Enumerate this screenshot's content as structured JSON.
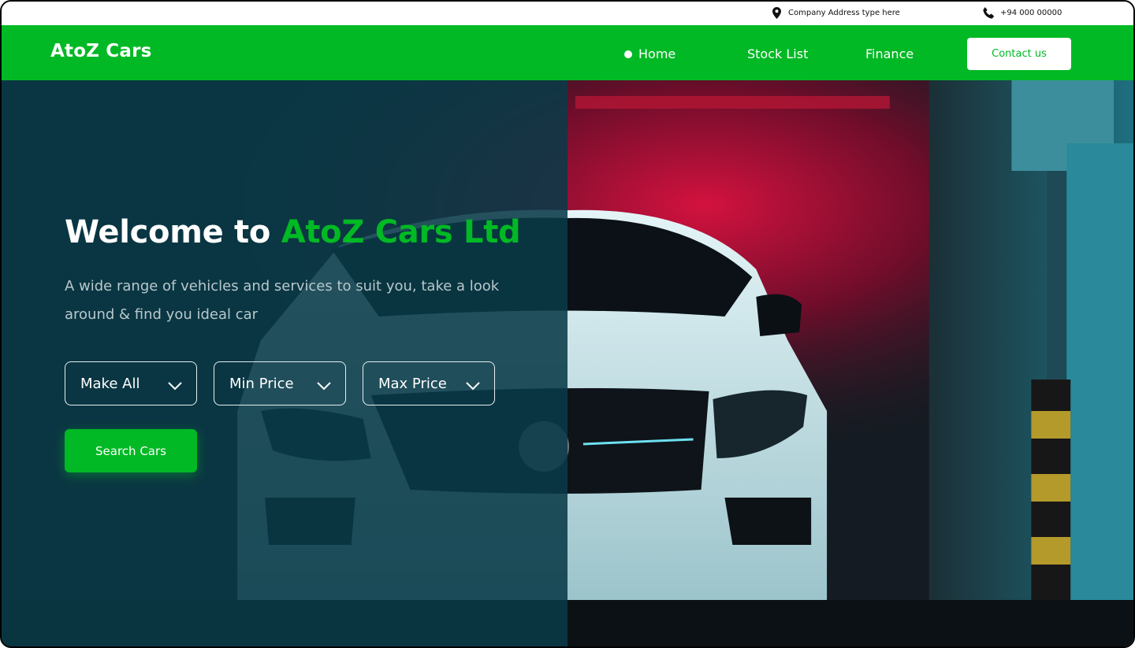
{
  "topbar": {
    "address": "Company Address type here",
    "phone": "+94 000 00000"
  },
  "nav": {
    "logo": "AtoZ Cars",
    "items": [
      {
        "label": "Home",
        "active": true
      },
      {
        "label": "Stock List",
        "active": false
      },
      {
        "label": "Finance",
        "active": false
      }
    ],
    "contact_label": "Contact us"
  },
  "hero": {
    "title_prefix": "Welcome to ",
    "title_accent": "AtoZ Cars Ltd",
    "subtitle": "A wide range of vehicles and services to suit you, take a look around & find you ideal car",
    "filters": {
      "make": "Make All",
      "min_price": "Min Price",
      "max_price": "Max Price"
    },
    "search_label": "Search Cars"
  },
  "colors": {
    "brand_green": "#00b924",
    "overlay_teal": "#093a48",
    "white": "#ffffff"
  },
  "icons": [
    "map-pin-icon",
    "phone-icon",
    "chevron-down-icon"
  ]
}
